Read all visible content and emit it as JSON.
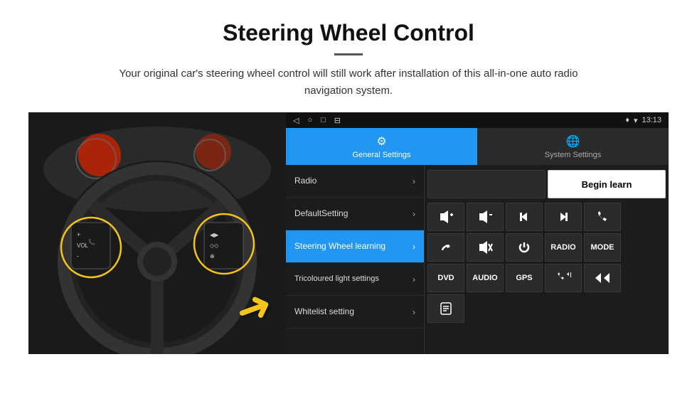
{
  "header": {
    "title": "Steering Wheel Control",
    "subtitle": "Your original car's steering wheel control will still work after installation of this all-in-one auto radio navigation system."
  },
  "status_bar": {
    "nav_icons": [
      "◁",
      "○",
      "□",
      "⊟"
    ],
    "signal": "▾",
    "wifi": "▾",
    "time": "13:13"
  },
  "tabs": [
    {
      "label": "General Settings",
      "icon": "⚙",
      "active": true
    },
    {
      "label": "System Settings",
      "icon": "🌐",
      "active": false
    }
  ],
  "menu_items": [
    {
      "label": "Radio",
      "active": false
    },
    {
      "label": "DefaultSetting",
      "active": false
    },
    {
      "label": "Steering Wheel learning",
      "active": true
    },
    {
      "label": "Tricoloured light settings",
      "active": false
    },
    {
      "label": "Whitelist setting",
      "active": false
    }
  ],
  "begin_learn_label": "Begin learn",
  "control_buttons": {
    "row1": [
      "🔊+",
      "🔊-",
      "⏮",
      "⏭",
      "📞"
    ],
    "row2": [
      "📞",
      "🔇",
      "⏻",
      "RADIO",
      "MODE"
    ],
    "row3": [
      "DVD",
      "AUDIO",
      "GPS",
      "📞⏮",
      "⏪⏩"
    ]
  }
}
